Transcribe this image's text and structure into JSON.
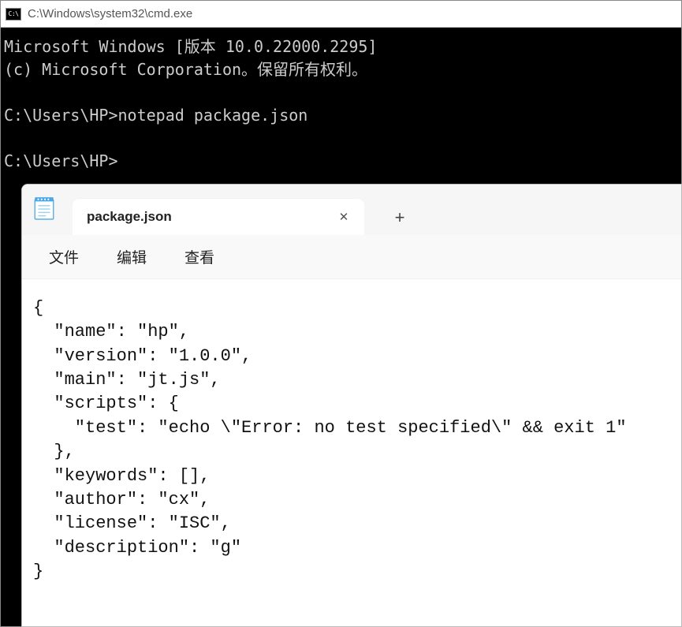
{
  "cmd": {
    "title": "C:\\Windows\\system32\\cmd.exe",
    "banner1": "Microsoft Windows [版本 10.0.22000.2295]",
    "banner2": "(c) Microsoft Corporation。保留所有权利。",
    "line1_prompt": "C:\\Users\\HP>",
    "line1_cmd": "notepad package.json",
    "line2_prompt": "C:\\Users\\HP>"
  },
  "notepad": {
    "tab_title": "package.json",
    "tab_close": "✕",
    "tab_add": "+",
    "menu": {
      "file": "文件",
      "edit": "编辑",
      "view": "查看"
    },
    "content": "{\n  \"name\": \"hp\",\n  \"version\": \"1.0.0\",\n  \"main\": \"jt.js\",\n  \"scripts\": {\n    \"test\": \"echo \\\"Error: no test specified\\\" && exit 1\"\n  },\n  \"keywords\": [],\n  \"author\": \"cx\",\n  \"license\": \"ISC\",\n  \"description\": \"g\"\n}"
  }
}
